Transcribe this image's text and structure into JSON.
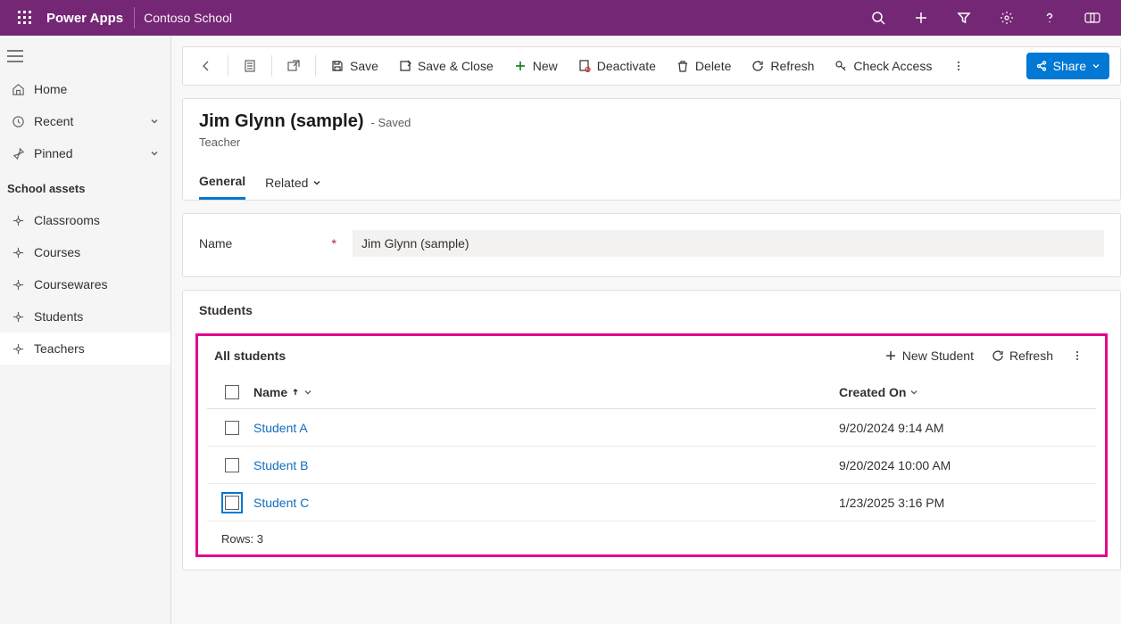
{
  "header": {
    "brand": "Power Apps",
    "app_name": "Contoso School"
  },
  "sidebar": {
    "home": "Home",
    "recent": "Recent",
    "pinned": "Pinned",
    "section_title": "School assets",
    "items": [
      {
        "label": "Classrooms"
      },
      {
        "label": "Courses"
      },
      {
        "label": "Coursewares"
      },
      {
        "label": "Students"
      },
      {
        "label": "Teachers"
      }
    ]
  },
  "commands": {
    "save": "Save",
    "save_close": "Save & Close",
    "new": "New",
    "deactivate": "Deactivate",
    "delete": "Delete",
    "refresh": "Refresh",
    "check_access": "Check Access",
    "share": "Share"
  },
  "record": {
    "title": "Jim Glynn (sample)",
    "saved_label": "- Saved",
    "entity": "Teacher",
    "tabs": {
      "general": "General",
      "related": "Related"
    }
  },
  "form": {
    "name_label": "Name",
    "name_value": "Jim Glynn (sample)"
  },
  "grid": {
    "section_title": "Students",
    "view_name": "All students",
    "new_btn": "New Student",
    "refresh_btn": "Refresh",
    "col_name": "Name",
    "col_created": "Created On",
    "rows": [
      {
        "name": "Student A",
        "created": "9/20/2024 9:14 AM"
      },
      {
        "name": "Student B",
        "created": "9/20/2024 10:00 AM"
      },
      {
        "name": "Student C",
        "created": "1/23/2025 3:16 PM"
      }
    ],
    "rows_label": "Rows: 3"
  }
}
